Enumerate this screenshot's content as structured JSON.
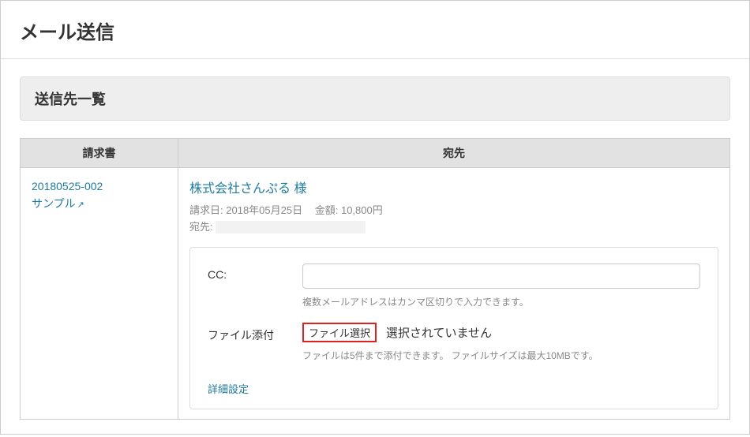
{
  "page": {
    "title": "メール送信"
  },
  "section": {
    "title": "送信先一覧"
  },
  "table": {
    "headers": {
      "invoice": "請求書",
      "destination": "宛先"
    },
    "row": {
      "invoice_number": "20180525-002",
      "invoice_name": "サンプル",
      "company": "株式会社さんぷる 様",
      "billing_date_label": "請求日:",
      "billing_date_value": "2018年05月25日",
      "amount_label": "金額:",
      "amount_value": "10,800円",
      "address_label": "宛先:"
    }
  },
  "form": {
    "cc_label": "CC:",
    "cc_help": "複数メールアドレスはカンマ区切りで入力できます。",
    "attach_label": "ファイル添付",
    "file_button": "ファイル選択",
    "file_status": "選択されていません",
    "attach_help": "ファイルは5件まで添付できます。 ファイルサイズは最大10MBです。",
    "advanced": "詳細設定"
  }
}
